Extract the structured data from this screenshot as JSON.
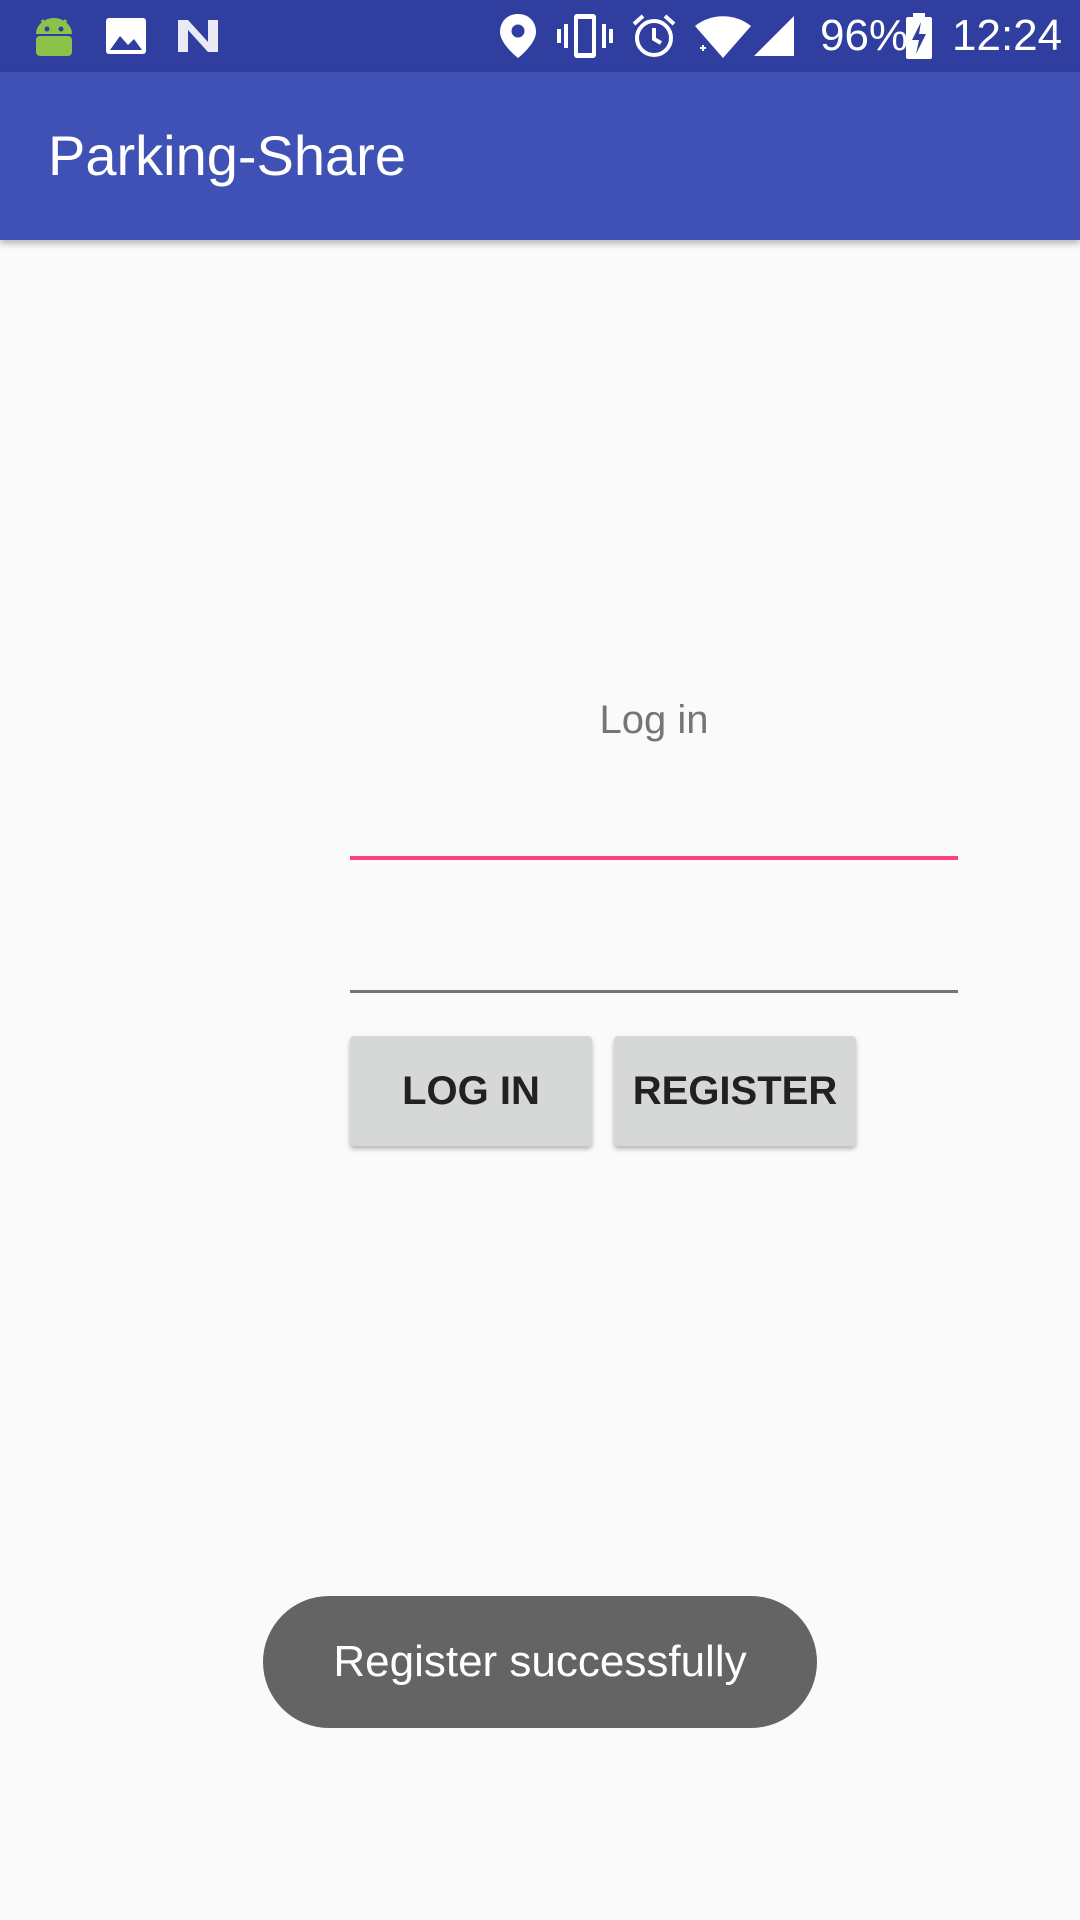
{
  "status_bar": {
    "notification_icons": [
      "android-icon",
      "image-icon",
      "n-icon"
    ],
    "system_icons": [
      "location-pin-icon",
      "vibrate-icon",
      "alarm-icon",
      "wifi-icon",
      "cell-signal-icon",
      "battery-charging-icon"
    ],
    "battery": "96%",
    "time": "12:24"
  },
  "app_bar": {
    "title": "Parking-Share"
  },
  "login": {
    "heading": "Log in",
    "username_value": "",
    "password_value": "",
    "login_button": "LOG IN",
    "register_button": "REGISTER"
  },
  "toast": {
    "message": "Register successfully"
  },
  "colors": {
    "status_bar": "#303f9f",
    "app_bar": "#3f51b5",
    "accent": "#ff4081",
    "background": "#fafafa",
    "button": "#d6d7d7",
    "toast": "#646464"
  }
}
